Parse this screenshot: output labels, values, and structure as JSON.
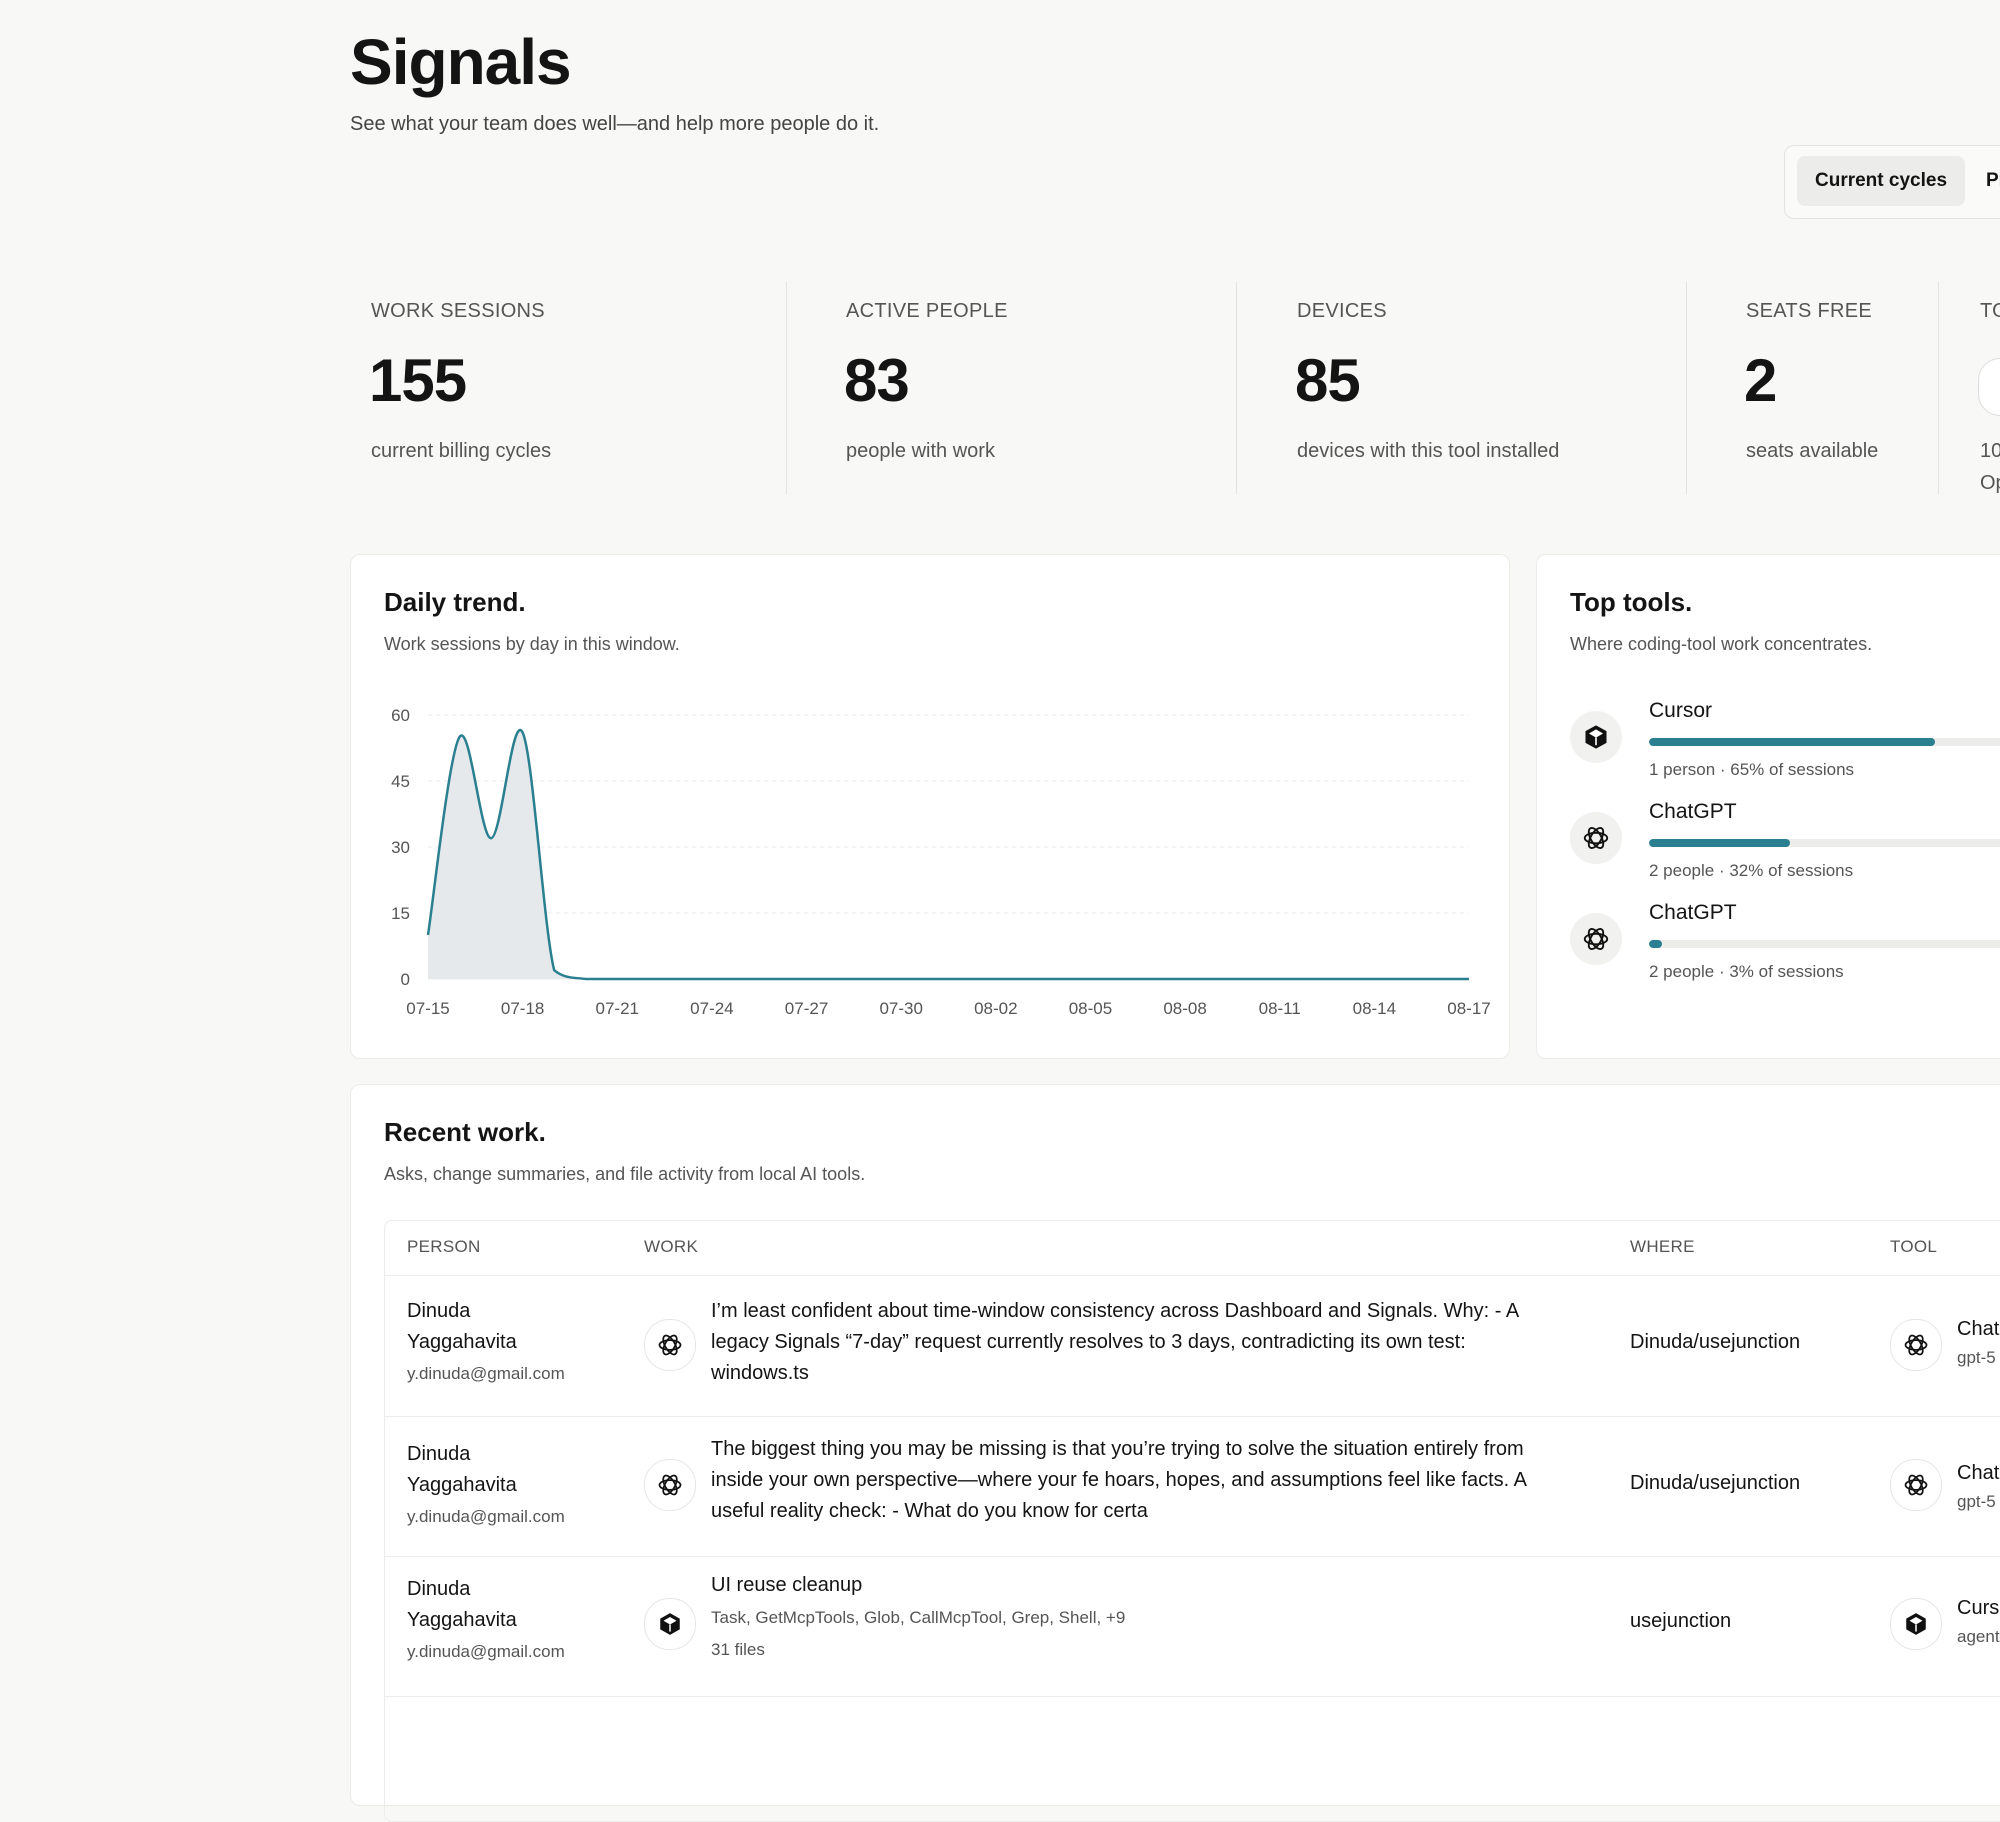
{
  "page": {
    "title": "Signals",
    "subtitle": "See what your team does well—and help more people do it.",
    "range_tabs": [
      "Current cycles",
      "Pr"
    ]
  },
  "stats": [
    {
      "label": "WORK SESSIONS",
      "value": "155",
      "desc": "current billing cycles"
    },
    {
      "label": "ACTIVE PEOPLE",
      "value": "83",
      "desc": "people with work"
    },
    {
      "label": "DEVICES",
      "value": "85",
      "desc": "devices with this tool installed"
    },
    {
      "label": "SEATS FREE",
      "value": "2",
      "desc": "seats available"
    },
    {
      "label": "TO",
      "desc_line1": "10",
      "desc_line2": "Op"
    }
  ],
  "trend": {
    "title": "Daily trend.",
    "subtitle": "Work sessions by day in this window."
  },
  "chart_data": {
    "type": "area",
    "x_ticks": [
      "07-15",
      "07-18",
      "07-21",
      "07-24",
      "07-27",
      "07-30",
      "08-02",
      "08-05",
      "08-08",
      "08-11",
      "08-14",
      "08-17"
    ],
    "y_ticks": [
      0,
      15,
      30,
      45,
      60
    ],
    "ylim": [
      0,
      60
    ],
    "x_start": "07-15",
    "x_end": "08-17",
    "series": [
      {
        "points": [
          [
            "07-15",
            10
          ],
          [
            "07-16",
            55
          ],
          [
            "07-17",
            32
          ],
          [
            "07-18",
            56
          ],
          [
            "07-19",
            2
          ],
          [
            "07-20",
            0
          ],
          [
            "07-21",
            0
          ],
          [
            "07-24",
            0
          ],
          [
            "07-27",
            0
          ],
          [
            "07-30",
            0
          ],
          [
            "08-02",
            0
          ],
          [
            "08-05",
            0
          ],
          [
            "08-08",
            0
          ],
          [
            "08-11",
            0
          ],
          [
            "08-14",
            0
          ],
          [
            "08-17",
            0
          ]
        ],
        "color": "#2a7f90"
      }
    ],
    "grid": true,
    "legend": "none"
  },
  "tools": {
    "title": "Top tools.",
    "subtitle": "Where coding-tool work concentrates.",
    "items": [
      {
        "name": "Cursor",
        "icon": "cursor-icon",
        "share": 0.65,
        "meta": "1 person · 65% of sessions"
      },
      {
        "name": "ChatGPT",
        "icon": "openai-icon",
        "share": 0.32,
        "meta": "2 people · 32% of sessions"
      },
      {
        "name": "ChatGPT",
        "icon": "openai-icon",
        "share": 0.03,
        "meta": "2 people · 3% of sessions"
      }
    ],
    "accent": "#2a7f90"
  },
  "recent": {
    "title": "Recent work.",
    "subtitle": "Asks, change summaries, and file activity from local AI tools.",
    "columns": [
      "PERSON",
      "WORK",
      "WHERE",
      "TOOL"
    ],
    "rows": [
      {
        "person_first": "Dinuda",
        "person_last": "Yaggahavita",
        "email": "y.dinuda@gmail.com",
        "work_icon": "openai-icon",
        "work": "I’m least confident about time-window consistency across Dashboard and Signals. Why: - A legacy Signals “7-day” request currently resolves to 3 days, contradicting its own test: windows.ts",
        "where": "Dinuda/usejunction",
        "tool": "Chat",
        "model": "gpt-5"
      },
      {
        "person_first": "Dinuda",
        "person_last": "Yaggahavita",
        "email": "y.dinuda@gmail.com",
        "work_icon": "openai-icon",
        "work": "The biggest thing you may be missing is that you’re trying to solve the situation entirely from inside your own perspective—where your fe hoars, hopes, and assumptions feel like facts. A useful reality check: - What do you know for certa",
        "where": "Dinuda/usejunction",
        "tool": "Chat",
        "model": "gpt-5"
      },
      {
        "person_first": "Dinuda",
        "person_last": "Yaggahavita",
        "email": "y.dinuda@gmail.com",
        "work_icon": "cursor-icon",
        "work_title": "UI reuse cleanup",
        "work_tools": "Task, GetMcpTools, Glob, CallMcpTool, Grep, Shell, +9",
        "work_files": "31 files",
        "where": "usejunction",
        "tool": "Curs",
        "model": "agent"
      }
    ]
  }
}
